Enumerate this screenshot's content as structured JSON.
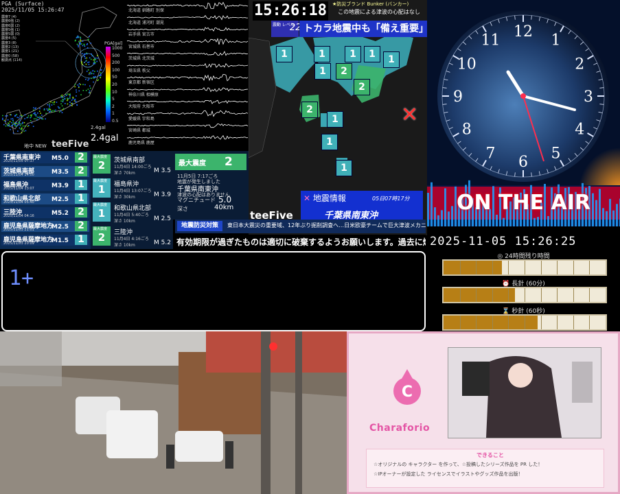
{
  "pga": {
    "title": "PGA (Surface)",
    "datetime": "2025/11/05 15:26:47",
    "legend": [
      "震度7 (4)",
      "震度6強 (2)",
      "震度6弱 (2)",
      "震度5強 (1)",
      "震度5弱 (0)",
      "震度4 (5)",
      "震度3 (8)",
      "震度2 (13)",
      "震度1 (21)",
      "震度0 (58)",
      "観測点 (114)"
    ],
    "scale_title": "PGA[gal]",
    "scale_ticks": [
      "1000",
      "500",
      "200",
      "100",
      "50",
      "20",
      "10",
      "5",
      "2",
      "1",
      "0.5"
    ],
    "value": "2.4gal",
    "value_small": "2.4gal",
    "brand_prefix": "地中 NEW",
    "brand": "teeFive"
  },
  "waveforms": {
    "labels": [
      "北海道 釧路町 別保",
      "北海道 浦河町 潮見",
      "岩手県 宮古市",
      "宮城県 石巻市",
      "茨城県 北茨城",
      "埼玉県 秩父",
      "東京都 新宿区",
      "神奈川県 相模原",
      "大阪府 大阪市",
      "愛媛県 宇和島",
      "宮崎県 都城",
      "鹿児島県 鹿屋"
    ]
  },
  "map": {
    "time": "15:26:18",
    "bunker_title": "★防災ブランド Bunker (バンカー)",
    "bunker_note": "この地震による津波の心配はなし",
    "shindo_label": "震動 レベル",
    "shindo_value": "22",
    "headline": "トカラ地震中も「備え重要」",
    "markers": [
      "1",
      "1",
      "1",
      "1",
      "1",
      "1",
      "2",
      "2",
      "2",
      "1",
      "1",
      "1"
    ],
    "brand": "teeFive",
    "info_title": "地震情報",
    "info_time": "05日07時17分",
    "info_place": "千葉県南東沖"
  },
  "clock": {
    "numerals": [
      "12",
      "1",
      "2",
      "3",
      "4",
      "5",
      "6",
      "7",
      "8",
      "9",
      "10",
      "11"
    ],
    "onair": "ON THE AIR"
  },
  "eq_list": [
    {
      "name": "千葉県南東沖",
      "date": "2025/11/05 07:17",
      "mag": "M5.0",
      "shindo": "2",
      "color": "#3cb46c"
    },
    {
      "name": "茨城県南部",
      "date": "2025/11/04 14:00",
      "mag": "M3.5",
      "shindo": "2",
      "color": "#3cb46c"
    },
    {
      "name": "福島県沖",
      "date": "2025/11/04 13:07",
      "mag": "M3.9",
      "shindo": "1",
      "color": "#40b0b8"
    },
    {
      "name": "和歌山県北部",
      "date": "2025/11/04 05:40",
      "mag": "M2.5",
      "shindo": "1",
      "color": "#40b0b8"
    },
    {
      "name": "三陸沖",
      "date": "2025/11/04 04:16",
      "mag": "M5.2",
      "shindo": "2",
      "color": "#3cb46c"
    },
    {
      "name": "鹿児島県薩摩地方",
      "date": "2025/11/03 21:01",
      "mag": "M2.5",
      "shindo": "2",
      "color": "#3cb46c"
    },
    {
      "name": "鹿児島県薩摩地方",
      "date": "2025/11/03 20:09",
      "mag": "M1.5",
      "shindo": "1",
      "color": "#40b0b8"
    }
  ],
  "details": [
    {
      "badge_title": "最大震度",
      "shindo": "2",
      "name": "茨城県南部",
      "date": "11月4日 14:00ごろ",
      "depth": "深さ 70km",
      "mag": "M 3.5"
    },
    {
      "badge_title": "最大震度",
      "shindo": "1",
      "name": "福島県沖",
      "date": "11月4日 13:07ごろ",
      "depth": "深さ 30km",
      "mag": "M 3.9"
    },
    {
      "badge_title": "最大震度",
      "shindo": "1",
      "name": "和歌山県北部",
      "date": "11月4日 5:40ごろ",
      "depth": "深さ 10km",
      "mag": "M 2.5"
    },
    {
      "badge_title": "最大震度",
      "shindo": "2",
      "name": "三陸沖",
      "date": "11月4日 4:16ごろ",
      "depth": "深さ 10km",
      "mag": "M 5.2"
    }
  ],
  "max_intensity": {
    "label": "最大震度",
    "value": "2",
    "date": "11月5日 7:17ごろ",
    "note": "地震が発生しました",
    "place": "千葉県南東沖",
    "tsunami": "津波の心配はありません",
    "mag_label": "マグニチュード",
    "mag": "5.0",
    "depth_label": "深さ",
    "depth": "40km"
  },
  "ticker": {
    "tag": "地震防災対策",
    "text": "東日本大震災の重要域、12年ぶり掘削調査へ…日米欧豪チームで巨大津波メカニズム解明目指す"
  },
  "scroll_text": "有効期限が過ぎたものは適切に破棄するようお願いします。過去に爆発",
  "big_value": "1+",
  "time_panel": {
    "datetime": "2025-11-05 15:26:25",
    "bars": [
      {
        "label": "◎ 24時間残り時間",
        "fraction": 0.36
      },
      {
        "label": "⏰ 長針 (60分)",
        "fraction": 0.44
      },
      {
        "label": "⌛ 秒針 (60秒)",
        "fraction": 0.58
      }
    ]
  },
  "ad": {
    "logo_text": "Charaforio",
    "headline": "できること",
    "line1": "☆オリジナルの キャラクター を作って、☆投稿したシリーズ作品を PR した！",
    "line2": "☆IPオーナーが設定した ライセンスでイラストやグッズ作品を出版！"
  }
}
